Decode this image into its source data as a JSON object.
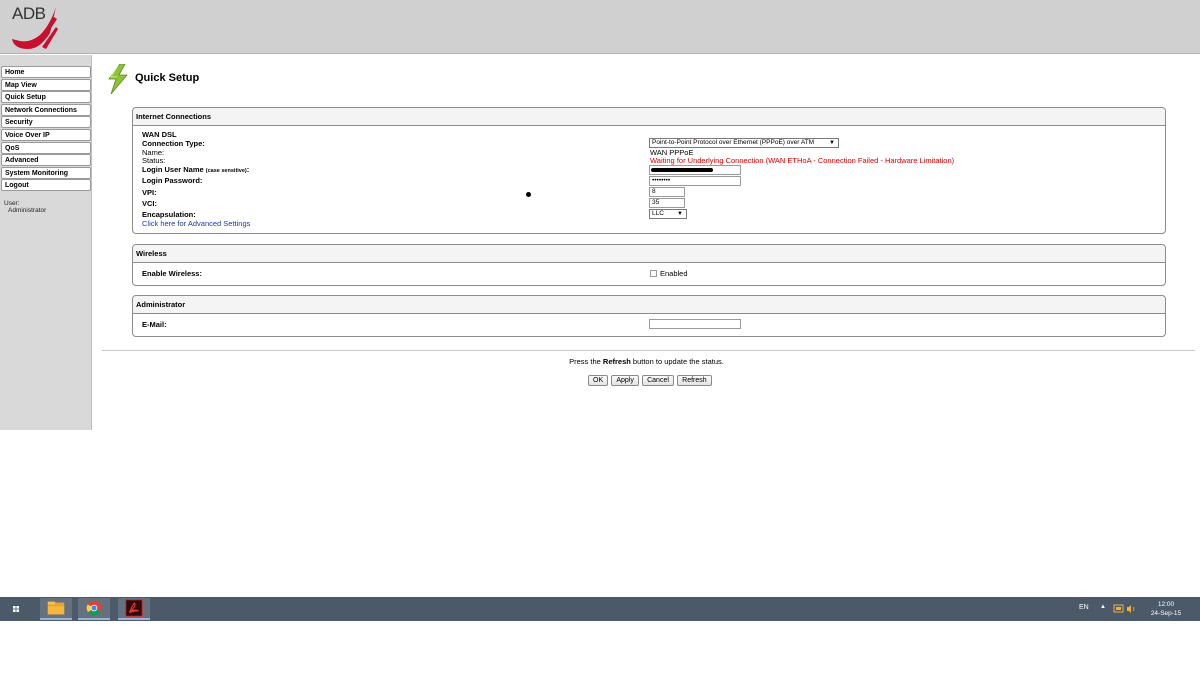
{
  "header": {
    "logo_text": "ADB"
  },
  "sidebar": {
    "items": [
      {
        "label": "Home"
      },
      {
        "label": "Map View"
      },
      {
        "label": "Quick Setup"
      },
      {
        "label": "Network Connections"
      },
      {
        "label": "Security"
      },
      {
        "label": "Voice Over IP"
      },
      {
        "label": "QoS"
      },
      {
        "label": "Advanced"
      },
      {
        "label": "System Monitoring"
      },
      {
        "label": "Logout"
      }
    ],
    "user_label": "User:",
    "user_name": "Administrator"
  },
  "page": {
    "title": "Quick Setup"
  },
  "internet": {
    "heading": "Internet Connections",
    "wan_label": "WAN DSL",
    "connection_type_label": "Connection Type:",
    "connection_type_value": "Point-to-Point Protocol over Ethernet (PPPoE) over ATM",
    "name_label": "Name:",
    "name_value": "WAN PPPoE",
    "status_label": "Status:",
    "status_value": "Waiting for Underlying Connection (WAN ETHoA - Connection Failed - Hardware Limitation)",
    "user_name_label": "Login User Name",
    "user_name_note": "(case sensitive)",
    "user_name_colon": ":",
    "password_label": "Login Password:",
    "password_value": "••••••••",
    "vpi_label": "VPI:",
    "vpi_value": "8",
    "vci_label": "VCI:",
    "vci_value": "35",
    "encapsulation_label": "Encapsulation:",
    "encapsulation_value": "LLC",
    "advanced_link": "Click here for Advanced Settings"
  },
  "wireless": {
    "heading": "Wireless",
    "enable_label": "Enable Wireless:",
    "enabled_text": "Enabled",
    "enabled": false
  },
  "administrator": {
    "heading": "Administrator",
    "email_label": "E-Mail:",
    "email_value": ""
  },
  "footer": {
    "hint_before": "Press the ",
    "hint_bold": "Refresh",
    "hint_after": " button to update the status.",
    "ok_label": "OK",
    "apply_label": "Apply",
    "cancel_label": "Cancel",
    "refresh_label": "Refresh"
  },
  "taskbar": {
    "language": "EN",
    "time": "12:00",
    "date": "24-Sep-15"
  },
  "colors": {
    "status_red": "#e00000",
    "link_blue": "#1a3aa8",
    "taskbar": "#4b5968",
    "brand_red": "#c8102e"
  }
}
